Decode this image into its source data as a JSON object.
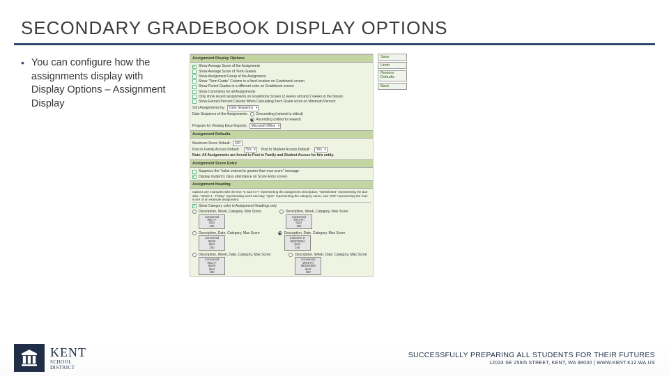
{
  "title": "SECONDARY GRADEBOOK DISPLAY OPTIONS",
  "bullet": "You can configure how the assignments display with Display Options – Assignment Display",
  "panel": {
    "sec1": {
      "header": "Assignment Display Options",
      "opts": [
        "Show Average Score of the Assignment",
        "Show Average Score of Term Grades",
        "Show Assignment Group of the Assignment",
        "Show \"Term Grade\" Column in a fixed location on Gradebook screen",
        "Show Period Grades in a different color on Gradebook screen",
        "Show Comments for all Assignments",
        "Only show recent assignments on Gradebook Screen (2 weeks old and 2 weeks in the future)",
        "Show Earned Percent Column When Calculating Term Grade score on Minimum Percent"
      ],
      "checked": [
        true,
        false,
        false,
        false,
        false,
        false,
        false,
        false
      ],
      "sort_label": "Sort Assignments by:",
      "sort_value": "Date Sequence",
      "dateseq_label": "Date Sequence of the Assignments:",
      "dateseq_opts": [
        "Descending (newest to oldest)",
        "Ascending (oldest to newest)"
      ],
      "dateseq_sel": 1,
      "excel_label": "Program for Viewing Excel Exports:",
      "excel_value": "Microsoft Office"
    },
    "sec2": {
      "header": "Assignment Defaults",
      "maxscore_label": "Maximum Score Default:",
      "maxscore_value": "100",
      "fam_label": "Post to Family Access Default:",
      "fam_value": "Yes",
      "stu_label": "Post to Student Access Default:",
      "stu_value": "Yes",
      "note": "Note: All Assignments are forced to Post to Family and Student Access for this entity."
    },
    "sec3": {
      "header": "Assignment Score Entry",
      "a": "Suppress the \"value entered is greater than max score\" message",
      "b": "Display student's class attendance on Score Entry screen",
      "a_chk": false,
      "b_chk": true
    },
    "sec4": {
      "header": "Assignment Heading",
      "help": "Options are examples with the text \"S was in A\" representing the assignment description, \"08/28/2004\" representing the due date, \"Week 4 - Friday\" representing week and day, \"Quiz\" representing the category name, and \"100\" representing the max score of an example assignment.",
      "showcat_label": "Show Category color in Assignment Headings only",
      "showcat_chk": true,
      "opts": [
        "Description, Week, Category, Max Score",
        "Description, Week, Category, Max Score",
        "Description, Date, Category, Max Score",
        "Description, Date, Category, Max Score",
        "Description, Week, Date, Category, Max Score",
        "Description, Week, Date, Category, Max Score"
      ],
      "sel_index": 3,
      "cards": [
        [
          "Conserved",
          "WK1-F",
          "Quiz",
          "100"
        ],
        [
          "Conserved",
          "WK1-Fri",
          "Quiz",
          "100"
        ],
        [
          "Conserved",
          "08/20",
          "Quiz",
          "100"
        ],
        [
          "Conserve w",
          "08/20/2004",
          "Quiz",
          "100"
        ],
        [
          "Conserved",
          "WK1-F",
          "08/20",
          "Quiz",
          "100"
        ],
        [
          "Conserved",
          "WK1-Fri",
          "08/20/2008",
          "Quiz",
          "100"
        ]
      ]
    },
    "buttons": [
      "Save",
      "Undo",
      "Restore Defaults",
      "Back"
    ]
  },
  "footer": {
    "brand_a": "KENT",
    "brand_b1": "SCHOOL",
    "brand_b2": "DISTRICT",
    "tagline": "SUCCESSFULLY PREPARING ALL STUDENTS FOR THEIR FUTURES",
    "addr": "12033 SE 256th STREET, KENT, WA 98030   |   WWW.KENT.K12.WA.US"
  }
}
